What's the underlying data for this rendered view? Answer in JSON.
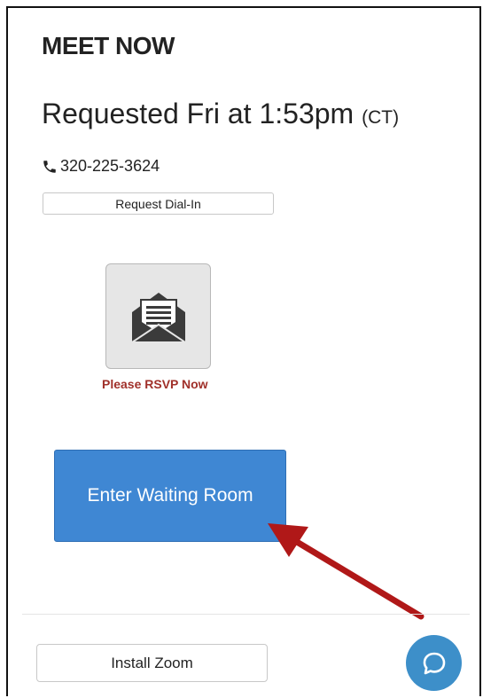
{
  "header": {
    "title": "MEET NOW"
  },
  "meeting": {
    "requested_text": "Requested Fri at 1:53pm",
    "timezone": "(CT)",
    "phone": "320-225-3624",
    "dial_in_label": "Request Dial-In"
  },
  "rsvp": {
    "icon": "envelope-letter-icon",
    "label": "Please RSVP Now"
  },
  "actions": {
    "enter_waiting_room_label": "Enter Waiting Room",
    "install_zoom_label": "Install Zoom"
  },
  "chat": {
    "icon": "chat-bubble-icon"
  },
  "colors": {
    "primary_button": "#3f87d3",
    "rsvp_text": "#a0302a",
    "chat_button": "#3d8fc9",
    "annotation_arrow": "#b01818"
  }
}
